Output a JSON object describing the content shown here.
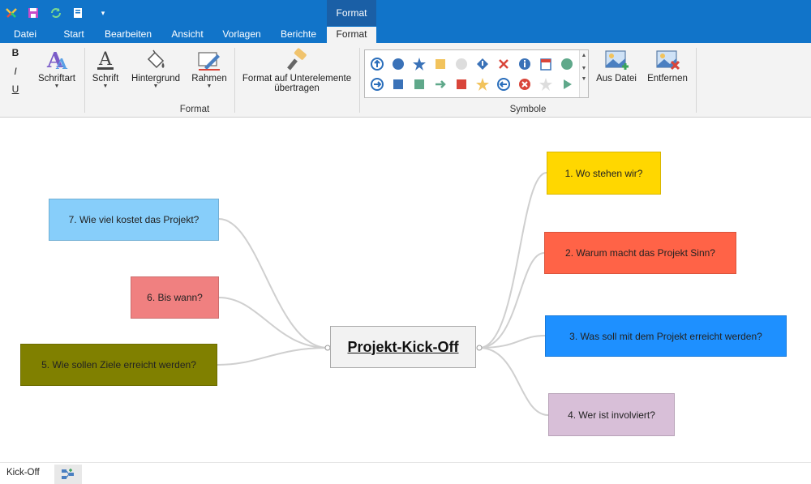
{
  "tabs": {
    "contextual": "Format",
    "items": [
      "Datei",
      "Start",
      "Bearbeiten",
      "Ansicht",
      "Vorlagen",
      "Berichte",
      "Format"
    ]
  },
  "format_group": {
    "bold": "B",
    "italic": "I",
    "underline": "U",
    "schriftart": "Schriftart",
    "schrift": "Schrift",
    "hintergrund": "Hintergrund",
    "rahmen": "Rahmen",
    "format_sub_line1": "Format auf Unterelemente",
    "format_sub_line2": "übertragen",
    "label": "Format"
  },
  "symbols_group": {
    "aus_datei": "Aus Datei",
    "entfernen": "Entfernen",
    "label": "Symbole"
  },
  "mindmap": {
    "center": "Projekt-Kick-Off",
    "nodes": {
      "n1": "1. Wo stehen wir?",
      "n2": "2. Warum macht das Projekt Sinn?",
      "n3": "3. Was soll mit dem Projekt erreicht werden?",
      "n4": "4. Wer ist involviert?",
      "n5": "5. Wie sollen Ziele erreicht werden?",
      "n6": "6. Bis wann?",
      "n7": "7. Wie viel kostet das Projekt?"
    },
    "colors": {
      "n1": "#ffd700",
      "n2": "#ff6347",
      "n3": "#1e90ff",
      "n4": "#d8bfd8",
      "n5": "#808000",
      "n6": "#f08080",
      "n7": "#87cefa"
    }
  },
  "status": {
    "sheet": "Kick-Off"
  }
}
